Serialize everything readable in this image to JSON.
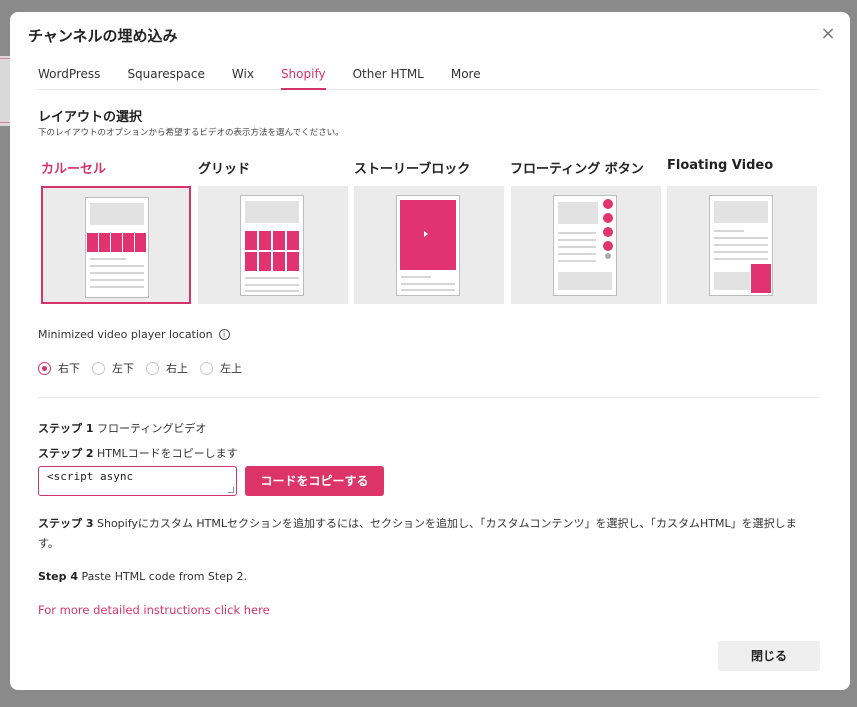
{
  "modal": {
    "title": "チャンネルの埋め込み",
    "close_icon": "×"
  },
  "tabs": [
    {
      "label": "WordPress",
      "active": false
    },
    {
      "label": "Squarespace",
      "active": false
    },
    {
      "label": "Wix",
      "active": false
    },
    {
      "label": "Shopify",
      "active": true
    },
    {
      "label": "Other HTML",
      "active": false
    },
    {
      "label": "More",
      "active": false
    }
  ],
  "layout_section": {
    "title": "レイアウトの選択",
    "subtitle": "下のレイアウトのオプションから希望するビデオの表示方法を選んでください。",
    "options": [
      {
        "label": "カルーセル",
        "selected": true
      },
      {
        "label": "グリッド",
        "selected": false
      },
      {
        "label": "ストーリーブロック",
        "selected": false
      },
      {
        "label": "フローティング ボタン",
        "selected": false
      },
      {
        "label": "Floating Video",
        "selected": false
      }
    ]
  },
  "player_location": {
    "label": "Minimized video player location",
    "info_icon": "i",
    "options": [
      {
        "label": "右下",
        "selected": true
      },
      {
        "label": "左下",
        "selected": false
      },
      {
        "label": "右上",
        "selected": false
      },
      {
        "label": "左上",
        "selected": false
      }
    ]
  },
  "steps": {
    "step1_label": "ステップ 1",
    "step1_text": "フローティングビデオ",
    "step2_label": "ステップ 2",
    "step2_text": "HTMLコードをコピーします",
    "code_value": "<script async",
    "copy_button": "コードをコピーする",
    "step3_label": "ステップ 3",
    "step3_text": "Shopifyにカスタム HTMLセクションを追加するには、セクションを追加し、「カスタムコンテンツ」を選択し、「カスタムHTML」を選択します。",
    "step4_label": "Step 4",
    "step4_text": "Paste HTML code from Step 2."
  },
  "more_link": "For more detailed instructions click here",
  "footer": {
    "close_button": "閉じる"
  },
  "colors": {
    "accent": "#d6336c",
    "accent_button": "#dc3469",
    "card_bg": "#ebebeb"
  }
}
